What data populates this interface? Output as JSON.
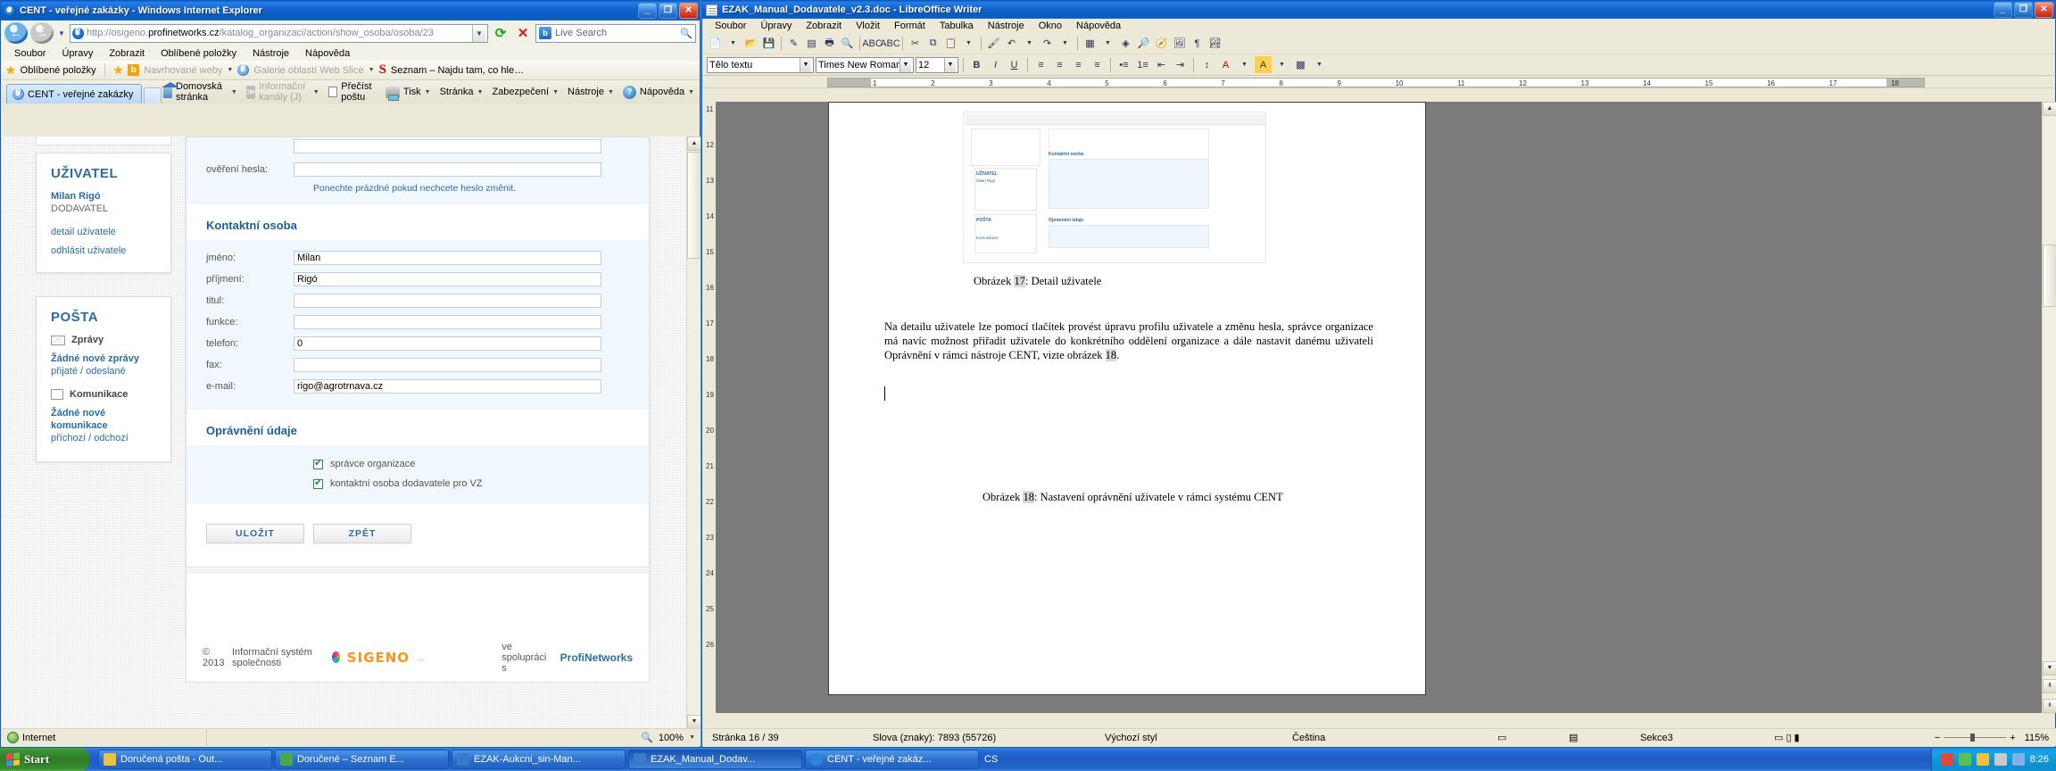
{
  "ie": {
    "title": "CENT - veřejné zakázky - Windows Internet Explorer",
    "url_prefix": "http://osigeno.",
    "url_domain": "profinetworks.cz",
    "url_path": "/katalog_organizaci/action/show_osoba/osoba/23",
    "search_placeholder": "Live Search",
    "menu": [
      "Soubor",
      "Úpravy",
      "Zobrazit",
      "Oblíbené položky",
      "Nástroje",
      "Nápověda"
    ],
    "favbar": {
      "favorites": "Oblíbené položky",
      "suggested": "Navrhované weby",
      "webslice": "Galerie oblastí Web Slice",
      "seznam": "Seznam – Najdu tam, co hle…"
    },
    "tab": "CENT - veřejné zakázky",
    "commands": {
      "home": "Domovská stránka",
      "feeds": "Informační kanály (J)",
      "mail": "Přečíst poštu",
      "print": "Tisk",
      "page": "Stránka",
      "security": "Zabezpečení",
      "tools": "Nástroje",
      "help": "Nápověda"
    },
    "status": {
      "zone": "Internet",
      "zoom": "100%"
    }
  },
  "page": {
    "sidebar": {
      "user_box": {
        "heading": "UŽIVATEL",
        "name": "Milan Rigó",
        "role": "DODAVATEL",
        "links": [
          "detail uživatele",
          "odhlásit uživatele"
        ]
      },
      "mail_box": {
        "heading": "POŠTA",
        "messages_label": "Zprávy",
        "messages_state": "Žádné nové zprávy",
        "messages_sub": "přijaté / odeslané",
        "comm_label": "Komunikace",
        "comm_state": "Žádné nové komunikace",
        "comm_sub": "příchozí / odchozí"
      }
    },
    "form": {
      "password_confirm_label": "ověření hesla:",
      "password_confirm_value": "",
      "password_hint": "Ponechte prázdné pokud nechcete heslo změnit.",
      "contact_heading": "Kontaktní osoba",
      "fields": [
        {
          "label": "jméno:",
          "value": "Milan"
        },
        {
          "label": "příjmení:",
          "value": "Rigó"
        },
        {
          "label": "titul:",
          "value": ""
        },
        {
          "label": "funkce:",
          "value": ""
        },
        {
          "label": "telefon:",
          "value": "0"
        },
        {
          "label": "fax:",
          "value": ""
        },
        {
          "label": "e-mail:",
          "value": "rigo@agrotrnava.cz"
        }
      ],
      "rights_heading": "Oprávnění údaje",
      "checkboxes": [
        {
          "label": "správce organizace",
          "checked": true
        },
        {
          "label": "kontaktní osoba dodavatele pro VZ",
          "checked": true
        }
      ],
      "save_button": "ULOŽIT",
      "back_button": "ZPĚT"
    },
    "footer": {
      "copyright": "© 2013",
      "text": "Informační systém společnosti",
      "brand": "SIGENO",
      "brand_dots": "...",
      "partner_text": "ve spolupráci s",
      "partner": "ProfiNetworks"
    }
  },
  "lo": {
    "title": "EZAK_Manual_Dodavatele_v2.3.doc - LibreOffice Writer",
    "menu": [
      "Soubor",
      "Úpravy",
      "Zobrazit",
      "Vložit",
      "Formát",
      "Tabulka",
      "Nástroje",
      "Okno",
      "Nápověda"
    ],
    "style_box": "Tělo textu",
    "font_box": "Times New Roman",
    "size_box": "12",
    "ruler_numbers": [
      "1",
      "2",
      "3",
      "4",
      "5",
      "6",
      "7",
      "8",
      "9",
      "10",
      "11",
      "12",
      "13",
      "14",
      "15",
      "16",
      "17",
      "18"
    ],
    "vruler_numbers": [
      "11",
      "12",
      "13",
      "14",
      "15",
      "16",
      "17",
      "18",
      "19",
      "20",
      "21",
      "22",
      "23",
      "24",
      "25",
      "26"
    ],
    "doc": {
      "caption1_prefix": "Obrázek ",
      "caption1_num": "17",
      "caption1_text": ": Detail uživatele",
      "body": "Na detailu uživatele lze pomocí tlačítek provést úpravu profilu uživatele a změnu hesla, správce organizace má navíc možnost přiřadit uživatele do konkrétního oddělení organizace a dále nastavit danému uživateli Oprávnění v rámci nástroje CENT, vizte obrázek ",
      "body_num": "18",
      "body_end": ".",
      "caption2_prefix": "Obrázek ",
      "caption2_num": "18",
      "caption2_text": ": Nastavení oprávnění uživatele v rámci systému CENT",
      "thumb_labels": [
        "UŽIVATEL",
        "Milan Rigó",
        "Kontaktní osoba",
        "POŠTA",
        "Komunikace",
        "Oprávnění údaje"
      ]
    },
    "status": {
      "page": "Stránka 16 / 39",
      "words": "Slova (znaky): 7893 (55726)",
      "style": "Výchozí styl",
      "lang": "Čeština",
      "section": "Sekce3",
      "zoom": "115%"
    }
  },
  "taskbar": {
    "start": "Start",
    "items": [
      {
        "label": "Doručená pošta - Out...",
        "color": "#f0c040",
        "active": false
      },
      {
        "label": "Doručené – Seznam E...",
        "color": "#4aa84a",
        "active": false
      },
      {
        "label": "EZAK-Aukcni_sin-Man...",
        "color": "#3a7bc8",
        "active": false
      },
      {
        "label": "EZAK_Manual_Dodav...",
        "color": "#3a7bc8",
        "active": true
      },
      {
        "label": "CENT - veřejné zakáz...",
        "color": "#2a86d8",
        "active": false
      }
    ],
    "lang": "CS",
    "clock": "8:26"
  }
}
